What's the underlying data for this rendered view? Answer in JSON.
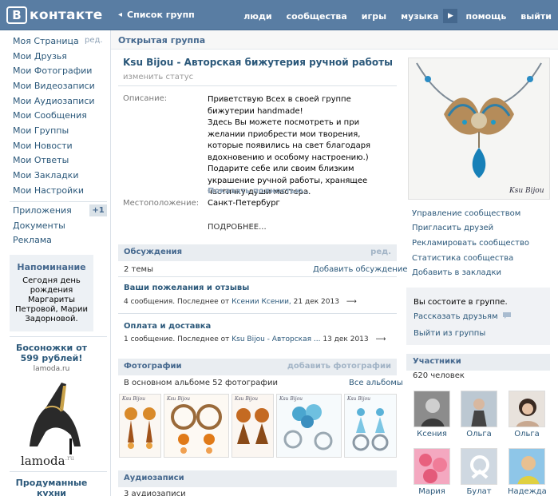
{
  "header": {
    "logo_letter": "В",
    "logo_text": "контакте",
    "back_arrow": "◂",
    "back_label": "Список групп",
    "nav": [
      "люди",
      "сообщества",
      "игры",
      "музыка"
    ],
    "play_icon": "▶",
    "help": "помощь",
    "logout": "выйти"
  },
  "sidebar": {
    "edit": "ред.",
    "items": [
      "Моя Страница",
      "Мои Друзья",
      "Мои Фотографии",
      "Мои Видеозаписи",
      "Мои Аудиозаписи",
      "Мои Сообщения",
      "Мои Группы",
      "Мои Новости",
      "Мои Ответы",
      "Мои Закладки",
      "Мои Настройки"
    ],
    "extra": [
      "Приложения",
      "Документы",
      "Реклама"
    ],
    "apps_badge": "+1",
    "reminder": {
      "title": "Напоминание",
      "text": "Сегодня день рождения Маргариты Петровой, Марии Задорновой."
    },
    "ad1": {
      "title": "Босоножки от 599 рублей!",
      "domain": "lamoda.ru",
      "brand": "lamoda",
      "brand_suffix": ".ru"
    },
    "ad2": {
      "title": "Продуманные кухни"
    }
  },
  "page": {
    "strip_title": "Открытая группа",
    "group_name": "Ksu Bijou - Авторская бижутерия ручной работы",
    "change_status": "изменить статус",
    "desc_label": "Описание:",
    "desc_text": "Приветствую Всех в своей группе бижутерии handmade!\nЗдесь Вы можете посмотреть и при желании приобрести мои творения, которые появились на свет благодаря вдохновению и особому настроению.) Подарите себе или своим близким украшение ручной работы, хранящее частичку души мастера.",
    "show_full": "Показать полностью..",
    "location_label": "Местоположение:",
    "location_value": "Санкт-Петербург",
    "more": "ПОДРОБНЕЕ..."
  },
  "discussions": {
    "title": "Обсуждения",
    "edit": "ред.",
    "count": "2 темы",
    "add": "Добавить обсуждение",
    "topics": [
      {
        "title": "Ваши пожелания и отзывы",
        "meta_prefix": "4 сообщения. Последнее от ",
        "author": "Ксении Ксении,",
        "date": " 21 дек 2013",
        "arrow": "⟶"
      },
      {
        "title": "Оплата и доставка",
        "meta_prefix": "1 сообщение. Последнее от ",
        "author": "Ksu Bijou - Авторская ...",
        "date": " 13 дек 2013",
        "arrow": "⟶"
      }
    ]
  },
  "photos": {
    "title": "Фотографии",
    "add": "добавить фотографии",
    "album_text": "В основном альбоме 52 фотографии",
    "all_albums": "Все альбомы",
    "watermark": "Ksu Bijou",
    "colors": [
      "#c8873a",
      "#d98a2a",
      "#b77a3c",
      "#6fb6d6",
      "#8cc3da"
    ]
  },
  "audio": {
    "title": "Аудиозаписи",
    "count": "3 аудиозаписи"
  },
  "right": {
    "avatar_caption": "Ksu Bijou",
    "links": [
      "Управление сообществом",
      "Пригласить друзей",
      "Рекламировать сообщество",
      "Статистика сообщества",
      "Добавить в закладки"
    ],
    "member_text": "Вы состоите в группе.",
    "share": "Рассказать друзьям",
    "leave": "Выйти из группы",
    "participants_title": "Участники",
    "participants_count": "620 человек",
    "people": [
      "Ксения",
      "Ольга",
      "Ольга",
      "Мария",
      "Булат",
      "Надежда"
    ]
  }
}
